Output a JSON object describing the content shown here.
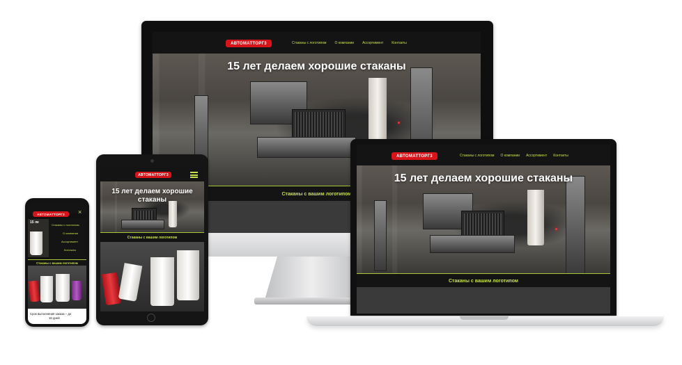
{
  "brand": {
    "logo_text": "АВТОМАТТОРГ3",
    "accent": "#d8141b",
    "nav_color": "#c4e04a"
  },
  "nav": [
    "Стаканы с логотипом",
    "О компании",
    "Ассортимент",
    "Контакты"
  ],
  "hero": {
    "headline": "15 лет делаем хорошие стаканы",
    "headline_tablet_line1": "15 лет делаем хорошие",
    "headline_tablet_line2": "стаканы"
  },
  "band": {
    "cta": "Стаканы с вашим логотипом"
  },
  "phone": {
    "hero_partial": "15 ле",
    "menu": [
      "Стаканы с логотипом",
      "О компании",
      "Ассортимент",
      "Контакты"
    ],
    "bottom_text_line1": "Срок выполнения заказа – до",
    "bottom_text_line2": "10 дней"
  },
  "icons": {
    "tablet_menu": "hamburger-icon",
    "phone_menu": "close-icon"
  }
}
